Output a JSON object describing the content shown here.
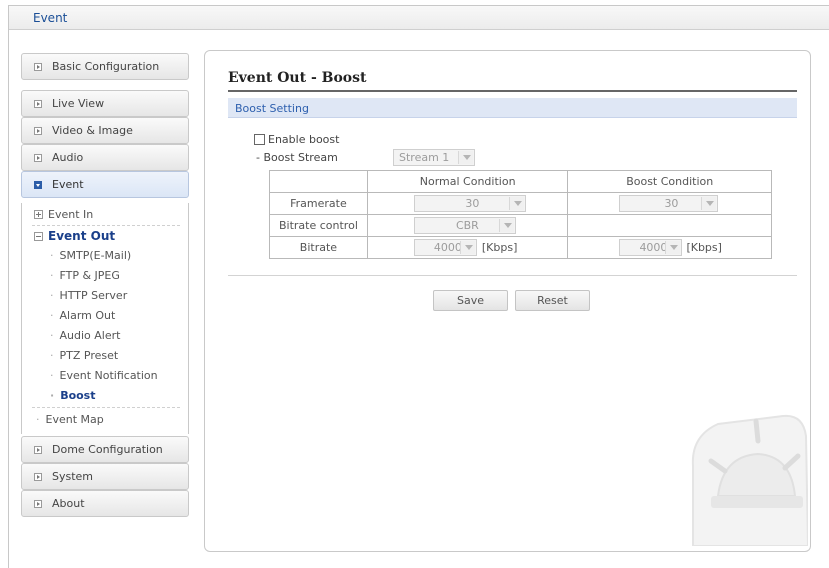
{
  "topbar": {
    "title": "Event"
  },
  "sidebar": {
    "basic_configuration": "Basic Configuration",
    "live_view": "Live View",
    "video_image": "Video & Image",
    "audio": "Audio",
    "event": "Event",
    "event_in": "Event In",
    "event_out": "Event Out",
    "event_out_items": [
      "SMTP(E-Mail)",
      "FTP & JPEG",
      "HTTP Server",
      "Alarm Out",
      "Audio Alert",
      "PTZ Preset",
      "Event Notification",
      "Boost"
    ],
    "event_map": "Event Map",
    "dome_configuration": "Dome Configuration",
    "system": "System",
    "about": "About"
  },
  "main": {
    "page_title": "Event Out - Boost",
    "section_title": "Boost Setting",
    "enable_boost_label": "Enable boost",
    "boost_stream_label": "- Boost Stream",
    "boost_stream_value": "Stream 1",
    "table": {
      "headers": [
        "",
        "Normal Condition",
        "Boost Condition"
      ],
      "framerate_label": "Framerate",
      "framerate_normal": "30",
      "framerate_boost": "30",
      "bitrate_control_label": "Bitrate control",
      "bitrate_control_normal": "CBR",
      "bitrate_label": "Bitrate",
      "bitrate_normal": "4000",
      "bitrate_boost": "4000",
      "bitrate_unit": "[Kbps]"
    },
    "save_label": "Save",
    "reset_label": "Reset"
  },
  "colors": {
    "accent": "#2c5da8",
    "section_bar": "#dfe7f5",
    "title_text": "#1a4e96"
  }
}
